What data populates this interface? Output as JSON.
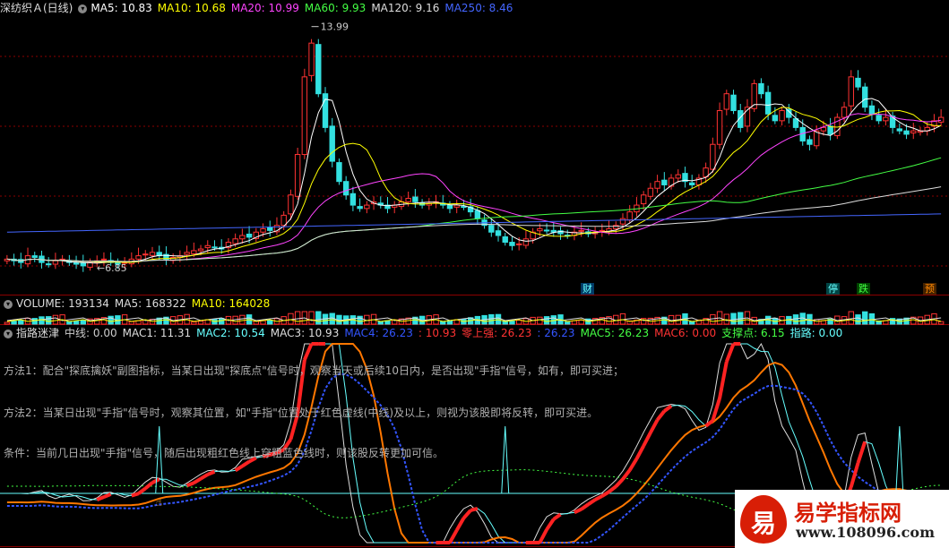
{
  "price_header": {
    "title": "深纺织Ａ(日线)",
    "items": [
      {
        "label": "MA5: 10.83",
        "color": "#ffffff"
      },
      {
        "label": "MA10: 10.68",
        "color": "#ffff00"
      },
      {
        "label": "MA20: 10.99",
        "color": "#ff44ff"
      },
      {
        "label": "MA60: 9.93",
        "color": "#44ff44"
      },
      {
        "label": "MA120: 9.16",
        "color": "#dddddd"
      },
      {
        "label": "MA250: 8.46",
        "color": "#4466ff"
      }
    ]
  },
  "volume_header": {
    "items": [
      {
        "label": "VOLUME: 193134",
        "color": "#dddddd"
      },
      {
        "label": "MA5: 168322",
        "color": "#dddddd"
      },
      {
        "label": "MA10: 164028",
        "color": "#ffff00"
      }
    ]
  },
  "indicator_header": {
    "title": "指路迷津",
    "items": [
      {
        "label": "中线: 0.00",
        "color": "#cccccc"
      },
      {
        "label": "MAC1: 11.31",
        "color": "#dddddd"
      },
      {
        "label": "MAC2: 10.54",
        "color": "#66ffff"
      },
      {
        "label": "MAC3: 10.93",
        "color": "#dddddd"
      },
      {
        "label": "MAC4: 26.23",
        "color": "#3355ff"
      },
      {
        "label": ": 10.93",
        "color": "#ff3333"
      },
      {
        "label": "零上强: 26.23",
        "color": "#ff3333"
      },
      {
        "label": ": 26.23",
        "color": "#3355ff"
      },
      {
        "label": "MAC5: 26.23",
        "color": "#44ff44"
      },
      {
        "label": "MAC6: 0.00",
        "color": "#ff3333"
      },
      {
        "label": "支撑点: 6.15",
        "color": "#44ff44"
      },
      {
        "label": "指路: 0.00",
        "color": "#66ffff"
      }
    ]
  },
  "notes": [
    "方法1：配合\"探底擒妖\"副图指标，当某日出现\"探底点\"信号时，观察当天或后续10日内，是否出现\"手指\"信号，如有，即可买进；",
    "方法2：当某日出现\"手指\"信号时，观察其位置，如\"手指\"位置处于红色虚线(中线)及以上，则视为该股即将反转，即可买进。",
    "条件：当前几日出现\"手指\"信号，随后出现粗红色线上穿粗蓝色线时，则该股反转更加可信。"
  ],
  "badges": [
    {
      "text": "财",
      "color": "#66ffff",
      "bg": "#003a66"
    },
    {
      "text": "停",
      "color": "#66ffff",
      "bg": "#004444"
    },
    {
      "text": "跌",
      "color": "#44ff44",
      "bg": "#004400"
    },
    {
      "text": "预",
      "color": "#ff8800",
      "bg": "#442200"
    }
  ],
  "watermark": {
    "logo_char": "易",
    "name": "易学指标网",
    "url": "www.108096.com"
  },
  "colors": {
    "up": "#ff3333",
    "down": "#33e0e0",
    "divider": "#8b0000",
    "grid": "#8b0000"
  },
  "chart_data": [
    {
      "type": "candlestick",
      "title": "深纺织Ａ(日线)",
      "ylim": [
        6.5,
        14.3
      ],
      "annotations": [
        {
          "label": "13.99",
          "value": 13.99
        },
        {
          "label": "6.85",
          "value": 6.85
        }
      ],
      "close": [
        7.1,
        7.05,
        7.0,
        7.2,
        7.15,
        7.0,
        6.95,
        7.05,
        7.1,
        7.0,
        6.95,
        6.9,
        7.0,
        7.05,
        7.1,
        7.0,
        6.95,
        7.0,
        7.1,
        7.2,
        7.25,
        7.3,
        7.2,
        7.1,
        7.15,
        7.2,
        7.3,
        7.35,
        7.4,
        7.5,
        7.45,
        7.4,
        7.6,
        7.7,
        7.8,
        7.75,
        7.9,
        8.0,
        7.95,
        8.1,
        8.4,
        9.0,
        10.2,
        12.5,
        13.5,
        12.0,
        11.0,
        10.0,
        9.4,
        9.0,
        8.7,
        8.6,
        8.7,
        8.8,
        8.7,
        8.6,
        8.7,
        8.8,
        8.9,
        8.8,
        8.7,
        8.75,
        8.8,
        8.7,
        8.6,
        8.7,
        8.65,
        8.5,
        8.3,
        8.1,
        7.9,
        7.8,
        7.6,
        7.5,
        7.55,
        7.7,
        7.9,
        8.0,
        7.95,
        7.9,
        7.85,
        7.8,
        7.9,
        7.95,
        7.85,
        7.9,
        7.95,
        8.0,
        8.1,
        8.3,
        8.5,
        8.7,
        9.0,
        9.2,
        9.4,
        9.3,
        9.5,
        9.6,
        9.4,
        9.3,
        9.5,
        9.8,
        10.5,
        11.5,
        12.0,
        11.5,
        11.0,
        11.6,
        12.3,
        12.0,
        11.4,
        11.2,
        11.5,
        11.3,
        11.0,
        10.6,
        10.5,
        10.9,
        11.0,
        10.8,
        11.3,
        11.6,
        12.5,
        12.2,
        11.6,
        11.4,
        11.2,
        11.3,
        11.0,
        10.9,
        10.8,
        10.9,
        10.9,
        11.0,
        11.2,
        11.3
      ]
    },
    {
      "type": "bar",
      "title": "VOLUME",
      "series": [
        {
          "name": "VOLUME",
          "values": [
            193134
          ]
        },
        {
          "name": "MA5",
          "values": [
            168322
          ]
        },
        {
          "name": "MA10",
          "values": [
            164028
          ]
        }
      ]
    },
    {
      "type": "line",
      "title": "指路迷津",
      "series": [
        {
          "name": "中线",
          "values": [
            0.0
          ]
        },
        {
          "name": "MAC1",
          "values": [
            11.31
          ]
        },
        {
          "name": "MAC2",
          "values": [
            10.54
          ]
        },
        {
          "name": "MAC3",
          "values": [
            10.93
          ]
        },
        {
          "name": "MAC4",
          "values": [
            26.23
          ]
        },
        {
          "name": "零上强",
          "values": [
            26.23
          ]
        },
        {
          "name": "MAC5",
          "values": [
            26.23
          ]
        },
        {
          "name": "MAC6",
          "values": [
            0.0
          ]
        },
        {
          "name": "支撑点",
          "values": [
            6.15
          ]
        },
        {
          "name": "指路",
          "values": [
            0.0
          ]
        }
      ]
    }
  ]
}
